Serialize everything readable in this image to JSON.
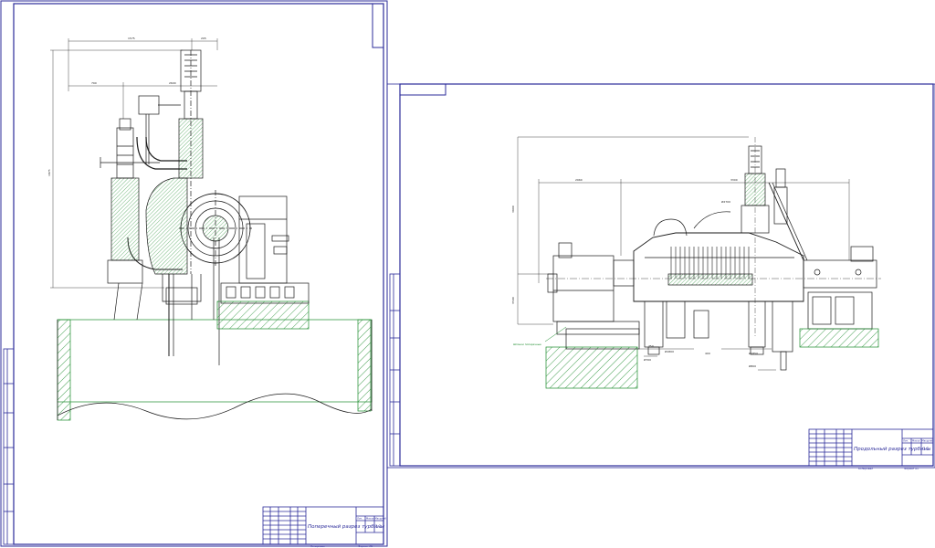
{
  "colors": {
    "frame": "#2b2b9a",
    "lines": "#1a1a1a",
    "dim": "#1a8a2a",
    "hatch": "#1a8a2a",
    "background": "#ffffff"
  },
  "sheet_left": {
    "title": "Поперечный разрез турбины",
    "scale": "1:1",
    "tb_labels": {
      "lit": "Лит.",
      "mass": "Масса",
      "scale": "Масштаб"
    },
    "bottom_left": "Копировал",
    "bottom_right": "Формат   А1"
  },
  "sheet_right": {
    "title": "Продольный разрез турбины",
    "scale": "1:1",
    "tb_labels": {
      "lit": "Лит.",
      "mass": "Масса",
      "scale": "Масштаб"
    },
    "bottom_left": "Копировал",
    "bottom_right": "Формат   А1",
    "leader_note": "Шпонки поперечные"
  },
  "dims_left": [
    "1575",
    "205",
    "790",
    "2600",
    "1875"
  ],
  "dims_right": [
    "3900",
    "2960",
    "3300",
    "Ø2700",
    "3500",
    "750",
    "400",
    "Ø1800",
    "Ø1850",
    "Ø700",
    "Ø800"
  ]
}
